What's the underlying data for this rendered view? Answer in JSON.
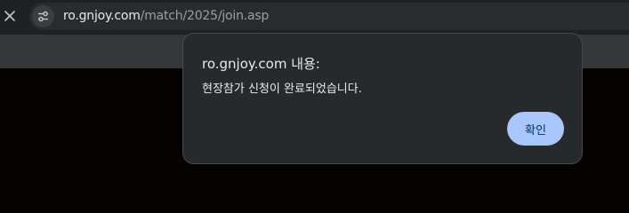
{
  "browser": {
    "close_icon": "close-icon",
    "site_info_icon": "tune-icon",
    "url_host": "ro.gnjoy.com",
    "url_path": "/match/2025/join.asp"
  },
  "dialog": {
    "title": "ro.gnjoy.com 내용:",
    "message": "현장참가 신청이 완료되었습니다.",
    "ok_label": "확인",
    "ok_color": "#a8c7fa"
  }
}
